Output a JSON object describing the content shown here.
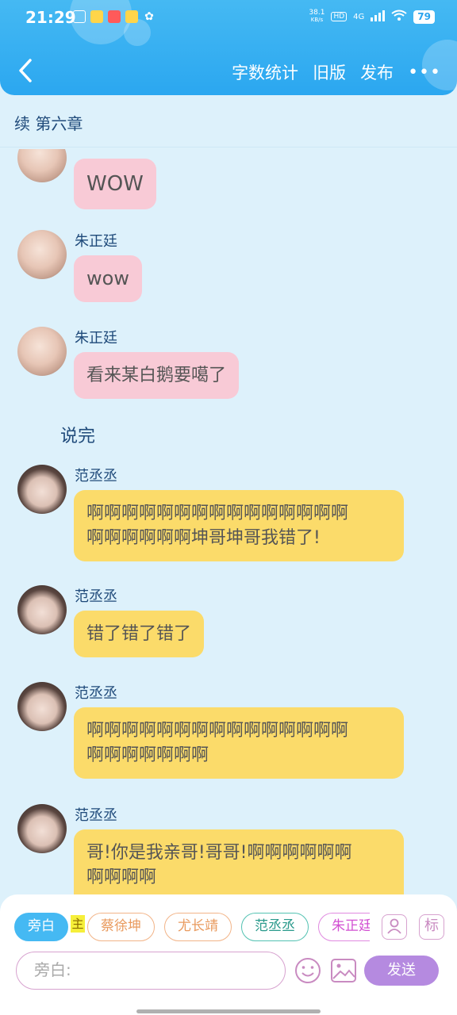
{
  "status_bar": {
    "time": "21:29",
    "net_speed_value": "38.1",
    "net_speed_unit": "KB/s",
    "hd": "HD",
    "network": "4G",
    "battery": "79"
  },
  "header": {
    "back_icon": "chevron-left-icon",
    "actions": [
      "字数统计",
      "旧版",
      "发布"
    ],
    "more_label": "•••"
  },
  "chapter_title": "续 第六章",
  "messages": [
    {
      "sender": "",
      "text": "WOW",
      "color": "pink"
    },
    {
      "sender": "朱正廷",
      "text": "wow",
      "color": "pink"
    },
    {
      "sender": "朱正廷",
      "text": "看来某白鹅要噶了",
      "color": "pink"
    },
    {
      "narration": "说完"
    },
    {
      "sender": "范丞丞",
      "text_lines": [
        "啊啊啊啊啊啊啊啊啊啊啊啊啊啊啊",
        "啊啊啊啊啊啊坤哥坤哥我错了!"
      ],
      "color": "yellow"
    },
    {
      "sender": "范丞丞",
      "text": "错了错了错了",
      "color": "yellow"
    },
    {
      "sender": "范丞丞",
      "text_lines": [
        "啊啊啊啊啊啊啊啊啊啊啊啊啊啊啊",
        "啊啊啊啊啊啊啊"
      ],
      "color": "yellow"
    },
    {
      "sender": "范丞丞",
      "text_lines": [
        "哥!你是我亲哥!哥哥!啊啊啊啊啊啊",
        "啊啊啊啊"
      ],
      "color": "yellow"
    }
  ],
  "bottom_bar": {
    "roles": [
      "旁白",
      "蔡徐坤",
      "尤长靖",
      "范丞丞",
      "朱正廷"
    ],
    "host_tag": "主",
    "role_manage_icon": "person-card-icon",
    "tag_button_label": "标",
    "input_placeholder": "旁白:",
    "emoji_icon": "smiley-icon",
    "image_icon": "image-icon",
    "send_label": "发送"
  },
  "colors": {
    "header": "#2ba7f0",
    "background": "#ddf1fb",
    "bubble_pink": "#f8cad6",
    "bubble_yellow": "#fbdb6a",
    "send_button": "#b58ae0"
  }
}
